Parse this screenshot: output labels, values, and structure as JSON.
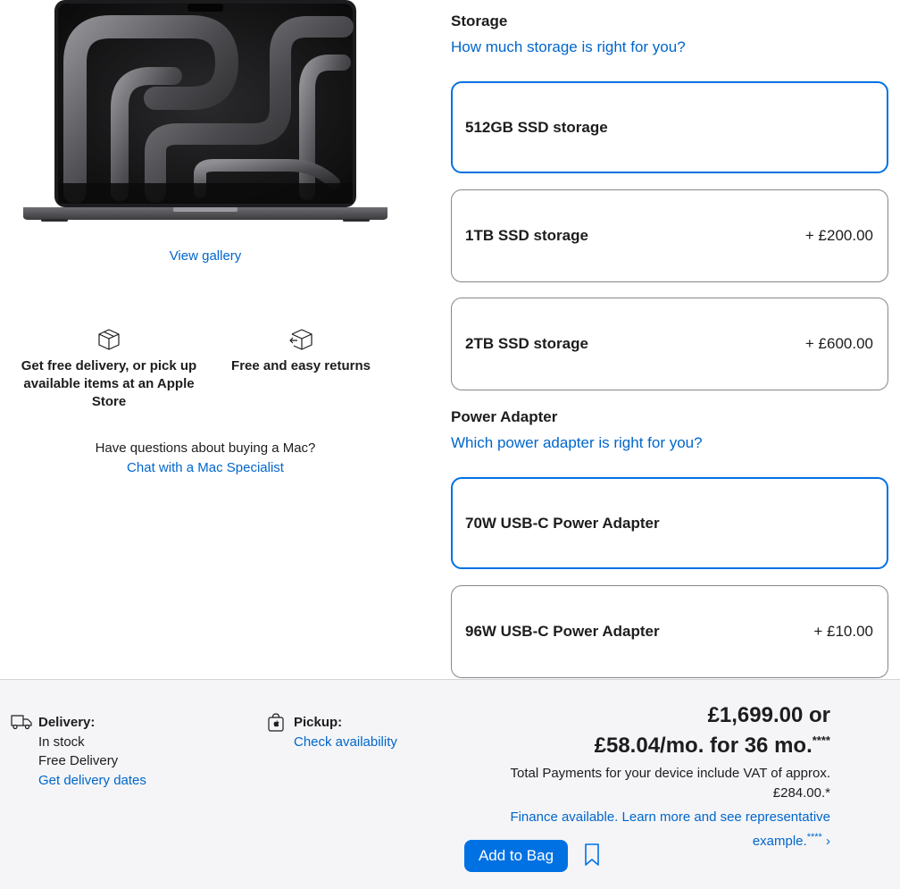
{
  "gallery": {
    "view_label": "View gallery"
  },
  "features": [
    {
      "icon": "box-icon",
      "text": "Get free delivery, or pick up available items at an Apple Store"
    },
    {
      "icon": "box-return-icon",
      "text": "Free and easy returns"
    }
  ],
  "questions": {
    "text": "Have questions about buying a Mac?",
    "link": "Chat with a Mac Specialist"
  },
  "storage": {
    "title": "Storage",
    "help_link": "How much storage is right for you?",
    "options": [
      {
        "name": "512GB SSD storage",
        "price": "",
        "selected": true
      },
      {
        "name": "1TB SSD storage",
        "price": "+ £200.00",
        "selected": false
      },
      {
        "name": "2TB SSD storage",
        "price": "+ £600.00",
        "selected": false
      }
    ]
  },
  "power": {
    "title": "Power Adapter",
    "help_link": "Which power adapter is right for you?",
    "options": [
      {
        "name": "70W USB-C Power Adapter",
        "price": "",
        "selected": true
      },
      {
        "name": "96W USB-C Power Adapter",
        "price": "+ £10.00",
        "selected": false
      }
    ]
  },
  "delivery": {
    "label": "Delivery:",
    "status": "In stock",
    "fee": "Free Delivery",
    "link": "Get delivery dates"
  },
  "pickup": {
    "label": "Pickup:",
    "link": "Check availability"
  },
  "price": {
    "line1": "£1,699.00 or",
    "line2": "£58.04/mo. for 36 mo.",
    "line2_sup": "****",
    "vat": "Total Payments for your device include VAT of approx. £284.00.*",
    "finance": "Finance available. Learn more and see representative example.",
    "finance_sup": "****",
    "finance_arrow": "›"
  },
  "actions": {
    "add_to_bag": "Add to Bag"
  },
  "colors": {
    "link": "#0066cc",
    "accent": "#0071e3",
    "bar_bg": "#f5f5f7"
  }
}
